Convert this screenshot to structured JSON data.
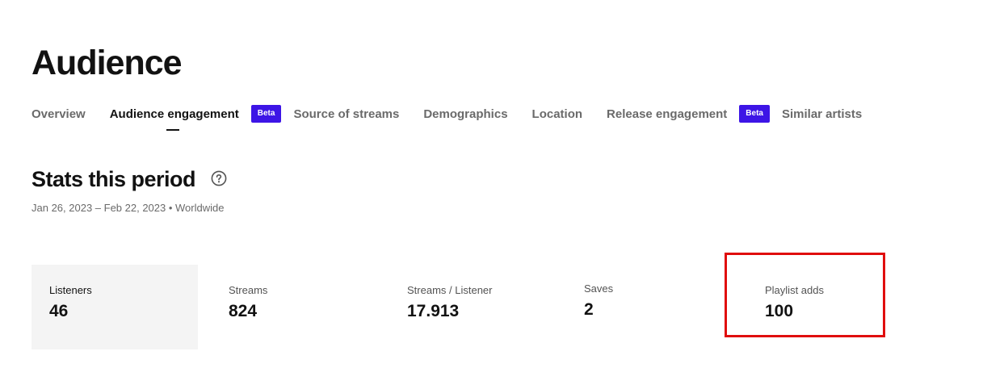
{
  "page": {
    "title": "Audience"
  },
  "tabs": [
    {
      "label": "Overview",
      "active": false
    },
    {
      "label": "Audience engagement",
      "active": true,
      "badge": "Beta"
    },
    {
      "label": "Source of streams",
      "active": false
    },
    {
      "label": "Demographics",
      "active": false
    },
    {
      "label": "Location",
      "active": false
    },
    {
      "label": "Release engagement",
      "active": false,
      "badge": "Beta"
    },
    {
      "label": "Similar artists",
      "active": false
    }
  ],
  "stats_section": {
    "title": "Stats this period",
    "help_icon": "question-circle-icon",
    "period": "Jan 26, 2023 – Feb 22, 2023 • Worldwide"
  },
  "stats": [
    {
      "label": "Listeners",
      "value": "46",
      "selected": true
    },
    {
      "label": "Streams",
      "value": "824",
      "selected": false
    },
    {
      "label": "Streams / Listener",
      "value": "17.913",
      "selected": false
    },
    {
      "label": "Saves",
      "value": "2",
      "selected": false
    },
    {
      "label": "Playlist adds",
      "value": "100",
      "selected": false
    }
  ],
  "colors": {
    "accent_badge": "#3d15e6",
    "highlight_border": "#e00d0d",
    "selected_card_bg": "#f4f4f4",
    "text_primary": "#121212",
    "text_secondary": "#6a6a6a"
  }
}
